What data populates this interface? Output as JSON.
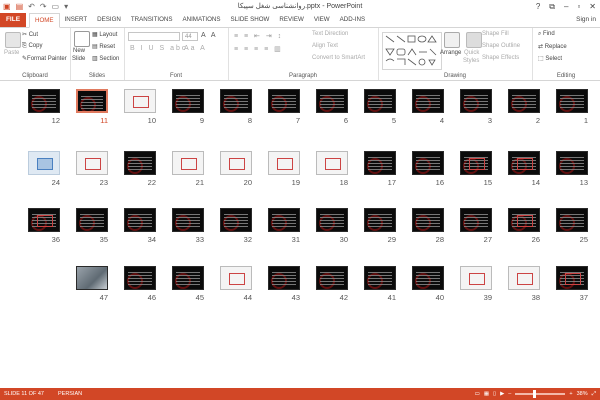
{
  "titlebar": {
    "title": "روانشناسی شغل سپیکا.pptx - PowerPoint",
    "min": "–",
    "max": "▫",
    "close": "✕",
    "help": "?",
    "restore": "⧉"
  },
  "tabs": {
    "file": "FILE",
    "items": [
      "HOME",
      "INSERT",
      "DESIGN",
      "TRANSITIONS",
      "ANIMATIONS",
      "SLIDE SHOW",
      "REVIEW",
      "VIEW",
      "ADD-INS"
    ],
    "active": "HOME",
    "signin": "Sign in"
  },
  "ribbon": {
    "clipboard": {
      "label": "Clipboard",
      "paste": "Paste",
      "cut": "Cut",
      "copy": "Copy",
      "format_painter": "Format Painter"
    },
    "slides": {
      "label": "Slides",
      "new_slide": "New",
      "new_slide2": "Slide",
      "layout": "Layout",
      "reset": "Reset",
      "section": "Section"
    },
    "font": {
      "label": "Font",
      "size": "44"
    },
    "paragraph": {
      "label": "Paragraph",
      "text_direction": "Text Direction",
      "align_text": "Align Text",
      "convert": "Convert to SmartArt"
    },
    "drawing": {
      "label": "Drawing",
      "arrange": "Arrange",
      "quick_styles": "Quick",
      "quick_styles2": "Styles",
      "shape_fill": "Shape Fill",
      "shape_outline": "Shape Outline",
      "shape_effects": "Shape Effects"
    },
    "editing": {
      "label": "Editing",
      "find": "Find",
      "replace": "Replace",
      "select": "Select"
    }
  },
  "slides": [
    {
      "n": "1"
    },
    {
      "n": "2"
    },
    {
      "n": "3"
    },
    {
      "n": "4"
    },
    {
      "n": "5"
    },
    {
      "n": "6"
    },
    {
      "n": "7"
    },
    {
      "n": "8"
    },
    {
      "n": "9"
    },
    {
      "n": "10"
    },
    {
      "n": "11"
    },
    {
      "n": "12"
    },
    {
      "n": "13"
    },
    {
      "n": "14"
    },
    {
      "n": "15"
    },
    {
      "n": "16"
    },
    {
      "n": "17"
    },
    {
      "n": "18"
    },
    {
      "n": "19"
    },
    {
      "n": "20"
    },
    {
      "n": "21"
    },
    {
      "n": "22"
    },
    {
      "n": "23"
    },
    {
      "n": "24"
    },
    {
      "n": "25"
    },
    {
      "n": "26"
    },
    {
      "n": "27"
    },
    {
      "n": "28"
    },
    {
      "n": "29"
    },
    {
      "n": "30"
    },
    {
      "n": "31"
    },
    {
      "n": "32"
    },
    {
      "n": "33"
    },
    {
      "n": "34"
    },
    {
      "n": "35"
    },
    {
      "n": "36"
    },
    {
      "n": "37"
    },
    {
      "n": "38"
    },
    {
      "n": "39"
    },
    {
      "n": "40"
    },
    {
      "n": "41"
    },
    {
      "n": "42"
    },
    {
      "n": "43"
    },
    {
      "n": "44"
    },
    {
      "n": "45"
    },
    {
      "n": "46"
    },
    {
      "n": "47"
    }
  ],
  "selected_slide": "11",
  "statusbar": {
    "slide_info": "SLIDE 11 OF 47",
    "language": "PERSIAN",
    "zoom": "38%"
  },
  "colors": {
    "accent": "#d24726",
    "slide_bg": "#0b0b0b",
    "selection": "#e07a5f"
  }
}
